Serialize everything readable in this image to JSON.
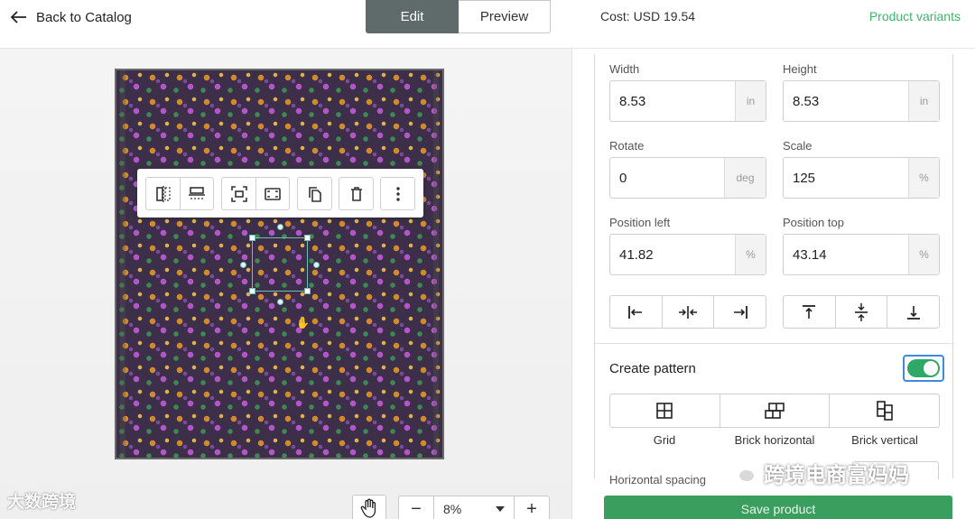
{
  "header": {
    "back_label": "Back to Catalog",
    "tabs": {
      "edit": "Edit",
      "preview": "Preview"
    },
    "cost": "Cost: USD 19.54",
    "variants_link": "Product variants"
  },
  "canvas": {
    "toolbar_icons": [
      "flip-horizontal-icon",
      "flip-vertical-icon",
      "fit-icon",
      "fill-icon",
      "duplicate-icon",
      "delete-icon",
      "more-icon"
    ],
    "zoom_value": "8%",
    "watermark": "大数跨境"
  },
  "properties": {
    "width": {
      "label": "Width",
      "value": "8.53",
      "unit": "in"
    },
    "height": {
      "label": "Height",
      "value": "8.53",
      "unit": "in"
    },
    "rotate": {
      "label": "Rotate",
      "value": "0",
      "unit": "deg"
    },
    "scale": {
      "label": "Scale",
      "value": "125",
      "unit": "%"
    },
    "position_left": {
      "label": "Position left",
      "value": "41.82",
      "unit": "%"
    },
    "position_top": {
      "label": "Position top",
      "value": "43.14",
      "unit": "%"
    }
  },
  "pattern": {
    "title": "Create pattern",
    "enabled": true,
    "options": [
      "Grid",
      "Brick horizontal",
      "Brick vertical"
    ],
    "horizontal_spacing_label": "Horizontal spacing"
  },
  "watermark2": "跨境电商富妈妈",
  "save_label": "Save product",
  "colors": {
    "accent_green": "#3fb36a",
    "edit_tab": "#5f6a6a",
    "toggle_on": "#2ea866"
  }
}
